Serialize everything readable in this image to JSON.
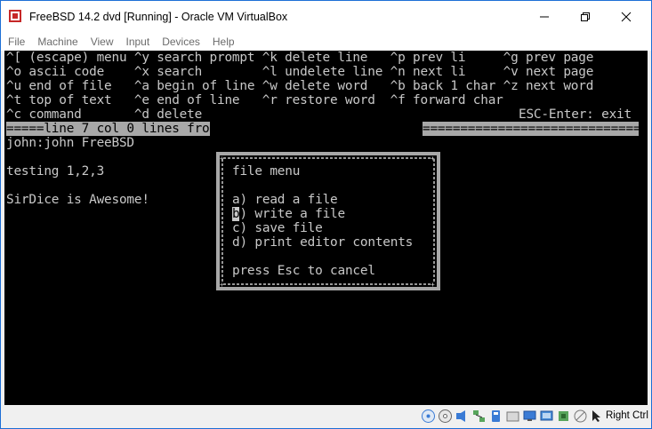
{
  "window": {
    "title": "FreeBSD 14.2 dvd [Running] - Oracle VM VirtualBox"
  },
  "menubar": {
    "items": [
      "File",
      "Machine",
      "View",
      "Input",
      "Devices",
      "Help"
    ]
  },
  "terminal": {
    "help_lines": [
      "^[ (escape) menu ^y search prompt ^k delete line   ^p prev li     ^g prev page",
      "^o ascii code    ^x search        ^l undelete line ^n next li     ^v next page",
      "^u end of file   ^a begin of line ^w delete word   ^b back 1 char ^z next word",
      "^t top of text   ^e end of line   ^r restore word  ^f forward char",
      "^c command       ^d delete"
    ],
    "esc_enter": "ESC-Enter: exit",
    "status_line": "=====line 7 col 0 lines fro",
    "status_fill": "=============================",
    "content_lines": [
      "john:john FreeBSD",
      "",
      "testing 1,2,3",
      "",
      "SirDice is Awesome!"
    ]
  },
  "dialog": {
    "title": "file menu",
    "options": [
      {
        "key": "a",
        "label": ") read a file"
      },
      {
        "key": "b",
        "label": ") write a file"
      },
      {
        "key": "c",
        "label": ") save file"
      },
      {
        "key": "d",
        "label": ") print editor contents"
      }
    ],
    "hint": "press Esc to cancel",
    "selected_key": "b"
  },
  "statusbar": {
    "host_key": "Right Ctrl",
    "icons": [
      "hard-disk-icon",
      "optical-drive-icon",
      "audio-icon",
      "network-icon",
      "usb-icon",
      "shared-folders-icon",
      "display-icon",
      "video-capture-icon",
      "cpu-icon",
      "mouse-integration-icon",
      "keyboard-icon"
    ]
  },
  "colors": {
    "terminal_fg": "#c8c8c8",
    "terminal_bg": "#000000",
    "inverse_bg": "#a8a8a8",
    "frame_accent": "#1d6fd6"
  }
}
